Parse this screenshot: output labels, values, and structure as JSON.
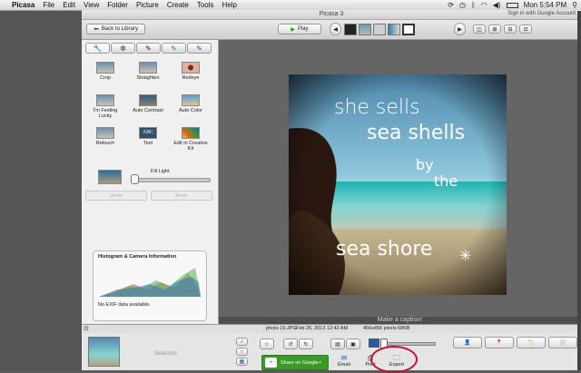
{
  "menubar": {
    "app": "Picasa",
    "items": [
      "File",
      "Edit",
      "View",
      "Folder",
      "Picture",
      "Create",
      "Tools",
      "Help"
    ],
    "clock": "Mon 5:54 PM"
  },
  "window": {
    "title": "Picasa 3",
    "signin": "Sign in with Google Account"
  },
  "toolbar": {
    "back_label": "Back to Library",
    "play_label": "Play"
  },
  "edit_panel": {
    "tools": [
      {
        "label": "Crop"
      },
      {
        "label": "Straighten"
      },
      {
        "label": "Redeye"
      },
      {
        "label": "I'm Feeling Lucky"
      },
      {
        "label": "Auto Contrast"
      },
      {
        "label": "Auto Color"
      },
      {
        "label": "Retouch"
      },
      {
        "label": "Text"
      },
      {
        "label": "Edit in Creative Kit"
      }
    ],
    "fill_light_label": "Fill Light",
    "fill_light_level": 0,
    "undo_label": "Undo",
    "redo_label": "Redo"
  },
  "histogram": {
    "title": "Histogram & Camera Information",
    "exif_text": "No EXIF data available."
  },
  "photo": {
    "line1": "she sells",
    "line2": "sea shells",
    "line3": "by",
    "line4": "the",
    "line5": "sea shore"
  },
  "caption_placeholder": "Make a caption!",
  "info": {
    "filename": "photo 19.JPG",
    "date": "Feb 26, 2013 12:42 AM",
    "dimensions": "456x456 pixels",
    "size": "68KB"
  },
  "tray": {
    "selection_label": "Selection",
    "share_label": "Share on Google+",
    "email_label": "Email",
    "print_label": "Print",
    "export_label": "Export"
  },
  "colors": {
    "share_green": "#3a9a28",
    "highlight_circle": "#c0143c"
  }
}
